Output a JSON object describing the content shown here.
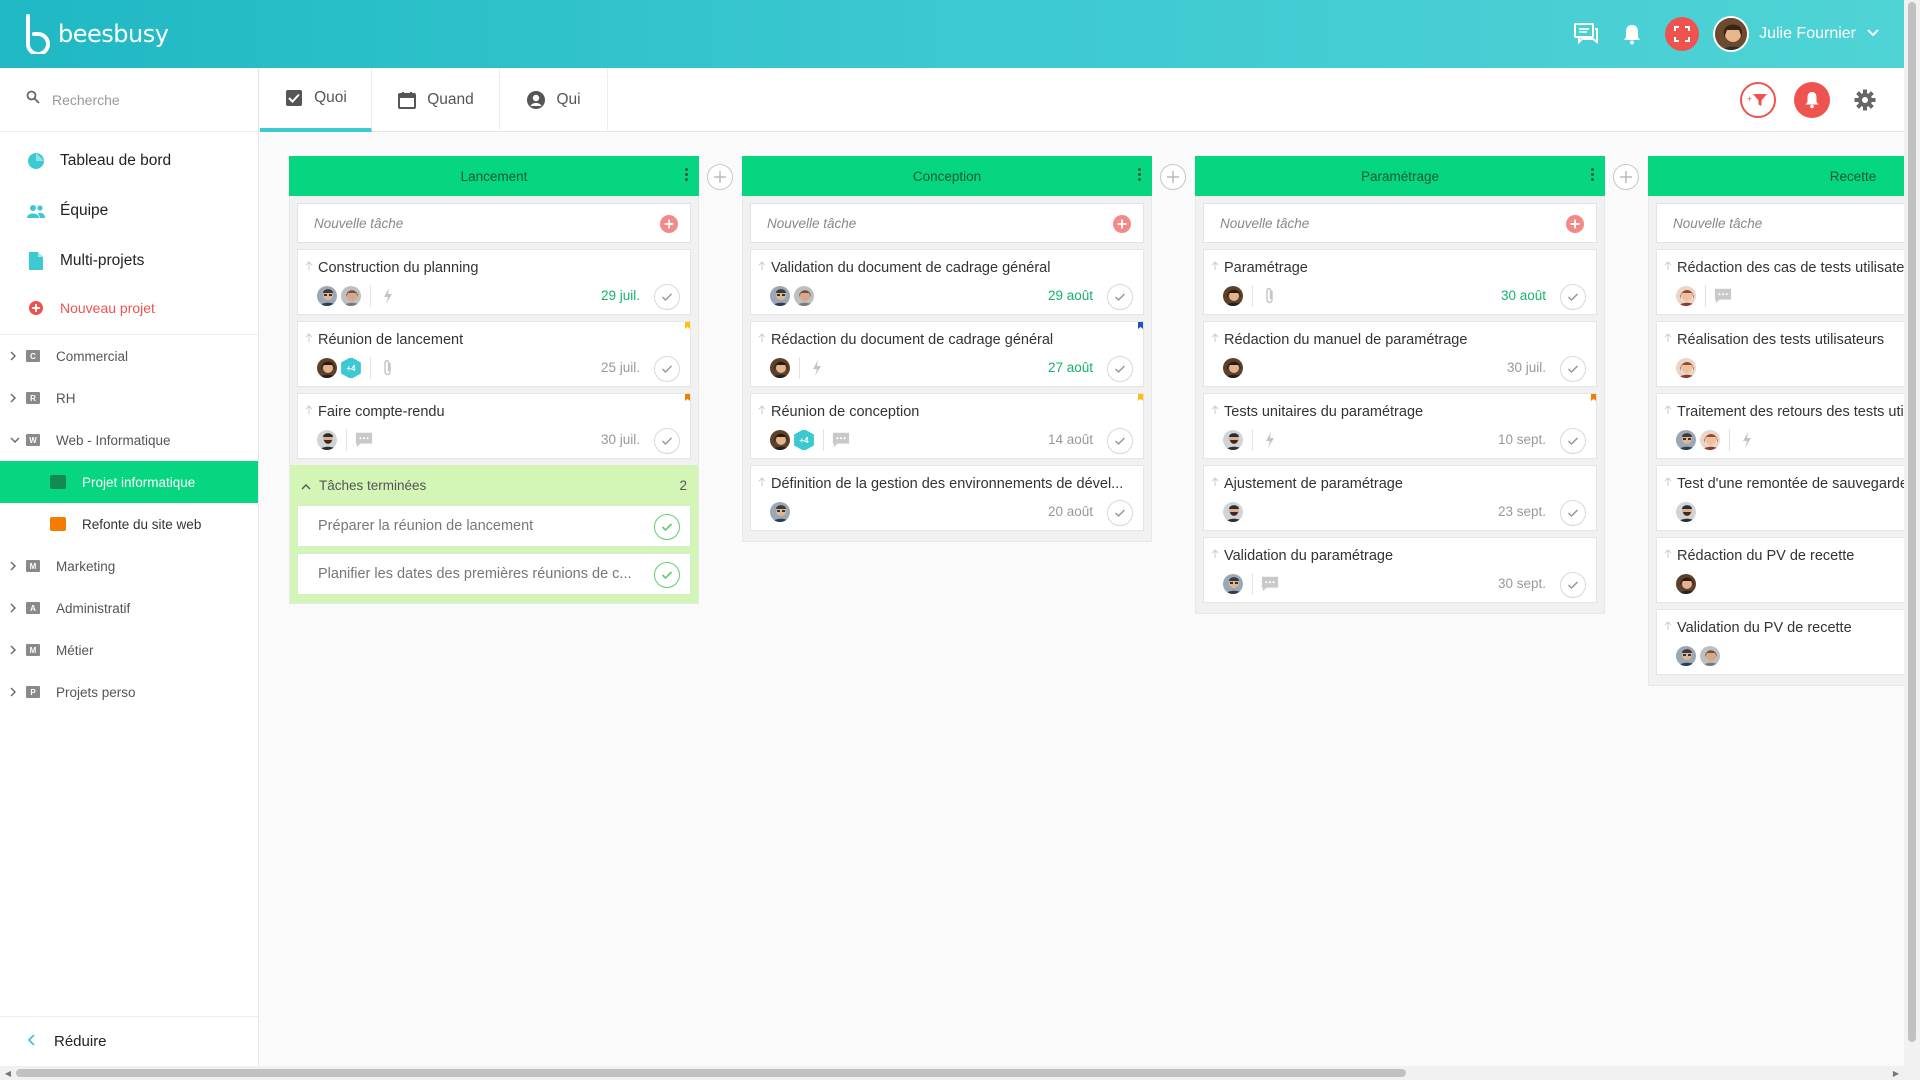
{
  "app": {
    "logo_text": "beesbusy"
  },
  "topbar": {
    "user_name": "Julie Fournier"
  },
  "sidebar": {
    "search_placeholder": "Recherche",
    "nav": [
      {
        "label": "Tableau de bord",
        "icon": "dashboard-icon"
      },
      {
        "label": "Équipe",
        "icon": "team-icon"
      },
      {
        "label": "Multi-projets",
        "icon": "multi-project-icon"
      }
    ],
    "new_project": "Nouveau projet",
    "categories": [
      {
        "letter": "C",
        "label": "Commercial",
        "expanded": false
      },
      {
        "letter": "R",
        "label": "RH",
        "expanded": false
      },
      {
        "letter": "W",
        "label": "Web - Informatique",
        "expanded": true,
        "projects": [
          {
            "label": "Projet informatique",
            "active": true,
            "color": "#138a4f"
          },
          {
            "label": "Refonte du site web",
            "active": false,
            "color": "#f57c00"
          }
        ]
      },
      {
        "letter": "M",
        "label": "Marketing",
        "expanded": false
      },
      {
        "letter": "A",
        "label": "Administratif",
        "expanded": false
      },
      {
        "letter": "M",
        "label": "Métier",
        "expanded": false
      },
      {
        "letter": "P",
        "label": "Projets perso",
        "expanded": false
      }
    ],
    "reduce": "Réduire"
  },
  "tabs": [
    {
      "label": "Quoi",
      "active": true
    },
    {
      "label": "Quand",
      "active": false
    },
    {
      "label": "Qui",
      "active": false
    }
  ],
  "board": {
    "new_task_placeholder": "Nouvelle tâche",
    "columns": [
      {
        "name": "Lancement",
        "tasks": [
          {
            "title": "Construction du planning",
            "avatars": [
              "man-glasses",
              "woman-grey"
            ],
            "meta": [
              "lightning"
            ],
            "date": "29 juil.",
            "date_color": "green",
            "flag": ""
          },
          {
            "title": "Réunion de lancement",
            "avatars": [
              "woman-dark",
              "+4"
            ],
            "meta": [
              "paperclip"
            ],
            "date": "25 juil.",
            "date_color": "grey",
            "flag": "#ffc107"
          },
          {
            "title": "Faire compte-rendu",
            "avatars": [
              "man-beard"
            ],
            "meta": [
              "comment"
            ],
            "date": "30 juil.",
            "date_color": "grey",
            "flag": "#f57c00"
          }
        ],
        "done": {
          "label": "Tâches terminées",
          "count": "2",
          "tasks": [
            "Préparer la réunion de lancement",
            "Planifier les dates des premières réunions de c..."
          ]
        }
      },
      {
        "name": "Conception",
        "tasks": [
          {
            "title": "Validation du document de cadrage général",
            "avatars": [
              "man-glasses",
              "woman-grey"
            ],
            "meta": [],
            "date": "29 août",
            "date_color": "green",
            "flag": ""
          },
          {
            "title": "Rédaction du document de cadrage général",
            "avatars": [
              "woman-dark"
            ],
            "meta": [
              "lightning"
            ],
            "date": "27 août",
            "date_color": "green",
            "flag": "#1e4fd1"
          },
          {
            "title": "Réunion de conception",
            "avatars": [
              "woman-dark",
              "+4"
            ],
            "meta": [
              "comment"
            ],
            "date": "14 août",
            "date_color": "grey",
            "flag": "#ffc107"
          },
          {
            "title": "Définition de la gestion des environnements de dével...",
            "avatars": [
              "man-glasses"
            ],
            "meta": [],
            "date": "20 août",
            "date_color": "grey",
            "flag": ""
          }
        ]
      },
      {
        "name": "Paramétrage",
        "tasks": [
          {
            "title": "Paramétrage",
            "avatars": [
              "woman-dark"
            ],
            "meta": [
              "paperclip"
            ],
            "date": "30 août",
            "date_color": "green",
            "flag": ""
          },
          {
            "title": "Rédaction du manuel de paramétrage",
            "avatars": [
              "woman-dark"
            ],
            "meta": [],
            "date": "30 juil.",
            "date_color": "grey",
            "flag": ""
          },
          {
            "title": "Tests unitaires du paramétrage",
            "avatars": [
              "man-beard"
            ],
            "meta": [
              "lightning"
            ],
            "date": "10 sept.",
            "date_color": "grey",
            "flag": "#f57c00"
          },
          {
            "title": "Ajustement de paramétrage",
            "avatars": [
              "man-beard"
            ],
            "meta": [],
            "date": "23 sept.",
            "date_color": "grey",
            "flag": ""
          },
          {
            "title": "Validation du paramétrage",
            "avatars": [
              "man-glasses"
            ],
            "meta": [
              "comment"
            ],
            "date": "30 sept.",
            "date_color": "grey",
            "flag": ""
          }
        ]
      },
      {
        "name": "Recette",
        "tasks": [
          {
            "title": "Rédaction des cas de tests utilisateurs",
            "avatars": [
              "woman-red"
            ],
            "meta": [
              "comment"
            ],
            "date": "",
            "date_color": "grey",
            "flag": ""
          },
          {
            "title": "Réalisation des tests utilisateurs",
            "avatars": [
              "woman-red"
            ],
            "meta": [],
            "date": "",
            "date_color": "grey",
            "flag": ""
          },
          {
            "title": "Traitement des retours des tests utilisateurs",
            "avatars": [
              "man-glasses",
              "woman-red"
            ],
            "meta": [
              "lightning"
            ],
            "date": "",
            "date_color": "grey",
            "flag": ""
          },
          {
            "title": "Test d'une remontée de sauvegarde",
            "avatars": [
              "man-beard"
            ],
            "meta": [],
            "date": "",
            "date_color": "grey",
            "flag": ""
          },
          {
            "title": "Rédaction du PV de recette",
            "avatars": [
              "woman-dark"
            ],
            "meta": [],
            "date": "",
            "date_color": "grey",
            "flag": ""
          },
          {
            "title": "Validation du PV de recette",
            "avatars": [
              "man-glasses",
              "woman-grey"
            ],
            "meta": [],
            "date": "",
            "date_color": "grey",
            "flag": ""
          }
        ]
      }
    ]
  },
  "colors": {
    "brand": "#3cc9d1",
    "column_header": "#06d67f",
    "accent_red": "#ef5350",
    "done_bg": "#d3f5b5"
  }
}
